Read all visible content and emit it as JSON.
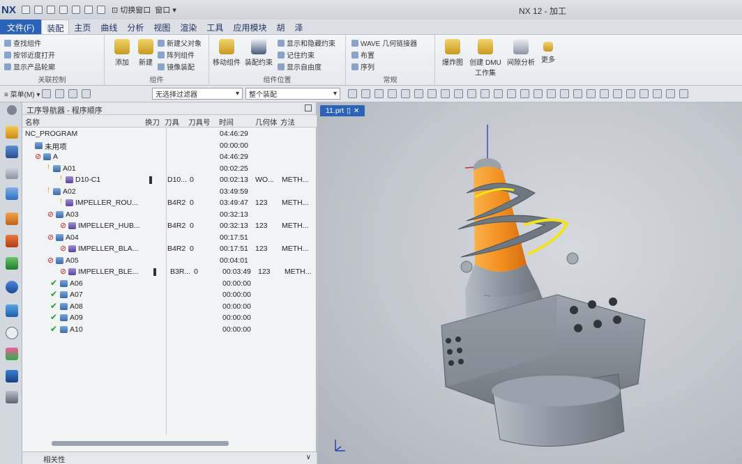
{
  "titlebar": {
    "logo": "NX",
    "switch_window": "⊡ 切换窗口",
    "window_menu": "窗口 ▾",
    "app_title": "NX 12 - 加工"
  },
  "menu_tabs": [
    "文件(F)",
    "装配",
    "主页",
    "曲线",
    "分析",
    "视图",
    "渲染",
    "工具",
    "应用模块",
    "胡",
    "泽"
  ],
  "ribbon": {
    "group_related": {
      "items": [
        "查找组件",
        "按邻近度打开",
        "显示产品轮廓"
      ],
      "title": "关联控制"
    },
    "group_component": {
      "add": "添加",
      "new": "新建",
      "items": [
        "新建父对象",
        "阵列组件",
        "镜像装配"
      ],
      "title": "组件"
    },
    "group_position": {
      "move": "移动组件",
      "constraint": "装配约束",
      "items": [
        "显示和隐藏约束",
        "记住约束",
        "显示自由度"
      ],
      "title": "组件位置"
    },
    "group_general": {
      "items": [
        "WAVE 几何链接器",
        "布置",
        "序列"
      ],
      "title": "常规"
    },
    "group_right": {
      "exploded": "爆炸图",
      "dmu_line1": "创建 DMU",
      "dmu_line2": "工作集",
      "clearance": "间隙分析",
      "more": "更多"
    }
  },
  "subbar": {
    "menu_button": "≡ 菜单(M) ▾",
    "filter": "无选择过滤器",
    "assembly": "整个装配"
  },
  "navigator": {
    "title": "工序导航器 - 程序顺序",
    "headers": {
      "name": "名称",
      "tool_change": "换刀",
      "tool": "刀具",
      "tool_number": "刀具号",
      "time": "时间",
      "geometry": "几何体",
      "method": "方法"
    },
    "rows": [
      {
        "name": "NC_PROGRAM",
        "time": "04:46:29"
      },
      {
        "name": "未用项",
        "time": "00:00:00"
      },
      {
        "name": "A",
        "time": "04:46:29"
      },
      {
        "name": "A01",
        "time": "00:02:25"
      },
      {
        "name": "D10-C1",
        "tool": "D10...",
        "tool_number": "0",
        "time": "00:02:13",
        "geometry": "WO...",
        "method": "METH..."
      },
      {
        "name": "A02",
        "time": "03:49:59"
      },
      {
        "name": "IMPELLER_ROU...",
        "tool": "B4R2",
        "tool_number": "0",
        "time": "03:49:47",
        "geometry": "123",
        "method": "METH..."
      },
      {
        "name": "A03",
        "time": "00:32:13"
      },
      {
        "name": "IMPELLER_HUB...",
        "tool": "B4R2",
        "tool_number": "0",
        "time": "00:32:13",
        "geometry": "123",
        "method": "METH..."
      },
      {
        "name": "A04",
        "time": "00:17:51"
      },
      {
        "name": "IMPELLER_BLA...",
        "tool": "B4R2",
        "tool_number": "0",
        "time": "00:17:51",
        "geometry": "123",
        "method": "METH..."
      },
      {
        "name": "A05",
        "time": "00:04:01"
      },
      {
        "name": "IMPELLER_BLE...",
        "tool": "B3R...",
        "tool_number": "0",
        "time": "00:03:49",
        "geometry": "123",
        "method": "METH..."
      },
      {
        "name": "A06",
        "time": "00:00:00"
      },
      {
        "name": "A07",
        "time": "00:00:00"
      },
      {
        "name": "A08",
        "time": "00:00:00"
      },
      {
        "name": "A09",
        "time": "00:00:00"
      },
      {
        "name": "A10",
        "time": "00:00:00"
      }
    ],
    "dependency_label": "相关性"
  },
  "graphics": {
    "part_tab": "11.prt"
  },
  "colors": {
    "accent_blue": "#2a63b8",
    "check_green": "#1aa02d",
    "model_orange": "#f0901c",
    "model_gray": "#8a939c"
  }
}
